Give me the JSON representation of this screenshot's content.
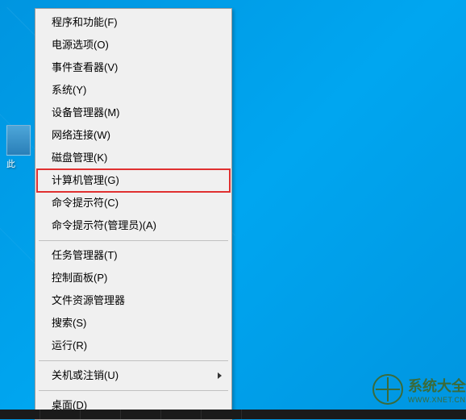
{
  "desktop": {
    "icon_label": "此"
  },
  "menu": {
    "groups": [
      [
        {
          "label": "程序和功能(F)",
          "name": "menu-programs-features",
          "submenu": false,
          "highlighted": false
        },
        {
          "label": "电源选项(O)",
          "name": "menu-power-options",
          "submenu": false,
          "highlighted": false
        },
        {
          "label": "事件查看器(V)",
          "name": "menu-event-viewer",
          "submenu": false,
          "highlighted": false
        },
        {
          "label": "系统(Y)",
          "name": "menu-system",
          "submenu": false,
          "highlighted": false
        },
        {
          "label": "设备管理器(M)",
          "name": "menu-device-manager",
          "submenu": false,
          "highlighted": false
        },
        {
          "label": "网络连接(W)",
          "name": "menu-network-connections",
          "submenu": false,
          "highlighted": false
        },
        {
          "label": "磁盘管理(K)",
          "name": "menu-disk-management",
          "submenu": false,
          "highlighted": false
        },
        {
          "label": "计算机管理(G)",
          "name": "menu-computer-management",
          "submenu": false,
          "highlighted": true
        },
        {
          "label": "命令提示符(C)",
          "name": "menu-command-prompt",
          "submenu": false,
          "highlighted": false
        },
        {
          "label": "命令提示符(管理员)(A)",
          "name": "menu-command-prompt-admin",
          "submenu": false,
          "highlighted": false
        }
      ],
      [
        {
          "label": "任务管理器(T)",
          "name": "menu-task-manager",
          "submenu": false,
          "highlighted": false
        },
        {
          "label": "控制面板(P)",
          "name": "menu-control-panel",
          "submenu": false,
          "highlighted": false
        },
        {
          "label": "文件资源管理器",
          "name": "menu-file-explorer",
          "submenu": false,
          "highlighted": false
        },
        {
          "label": "搜索(S)",
          "name": "menu-search",
          "submenu": false,
          "highlighted": false
        },
        {
          "label": "运行(R)",
          "name": "menu-run",
          "submenu": false,
          "highlighted": false
        }
      ],
      [
        {
          "label": "关机或注销(U)",
          "name": "menu-shutdown-signout",
          "submenu": true,
          "highlighted": false
        }
      ],
      [
        {
          "label": "桌面(D)",
          "name": "menu-desktop",
          "submenu": false,
          "highlighted": false
        }
      ]
    ]
  },
  "watermark": {
    "title": "系统大全",
    "sub": "WWW.XNET.CN"
  }
}
